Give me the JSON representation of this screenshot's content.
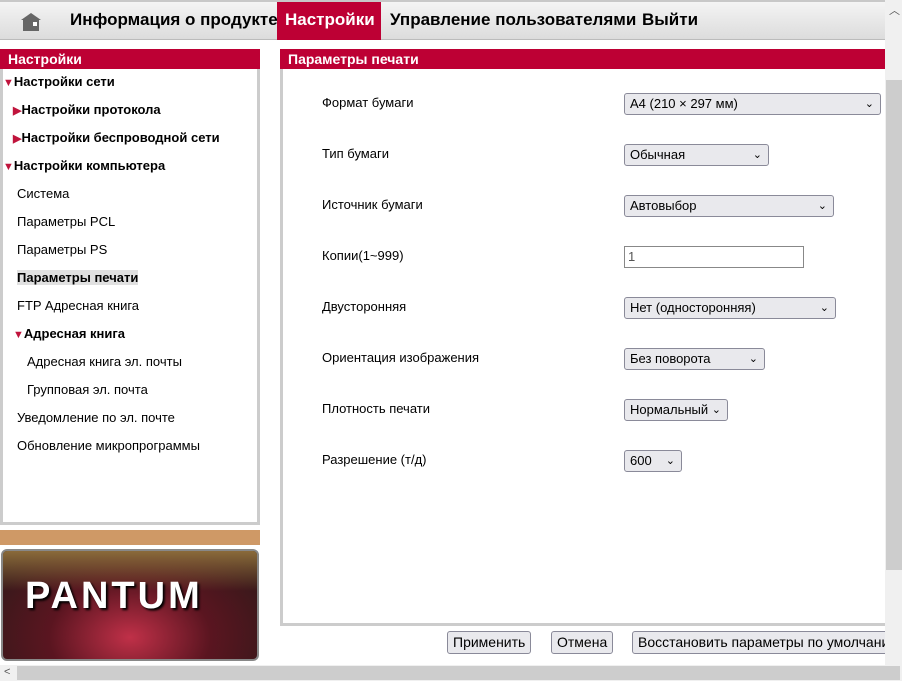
{
  "nav": {
    "items": [
      "Информация о продукте",
      "Настройки",
      "Управление пользователями",
      "Выйти"
    ],
    "active": "Настройки"
  },
  "sidebar": {
    "title": "Настройки",
    "items": [
      {
        "label": "Настройки сети",
        "level": 0,
        "expanded": true
      },
      {
        "label": "Настройки протокола",
        "level": 1,
        "collapsed": true
      },
      {
        "label": "Настройки беспроводной сети",
        "level": 1,
        "collapsed": true
      },
      {
        "label": "Настройки компьютера",
        "level": 0,
        "expanded": true
      },
      {
        "label": "Система"
      },
      {
        "label": "Параметры PCL"
      },
      {
        "label": "Параметры PS"
      },
      {
        "label": "Параметры печати",
        "selected": true
      },
      {
        "label": "FTP Адресная книга"
      },
      {
        "label": "Адресная книга",
        "expanded": true
      },
      {
        "label": "Адресная книга эл. почты"
      },
      {
        "label": "Групповая эл. почта"
      },
      {
        "label": "Уведомление по эл. почте"
      },
      {
        "label": "Обновление микропрограммы"
      }
    ]
  },
  "logo": "PANTUM",
  "main": {
    "title": "Параметры печати",
    "fields": [
      {
        "label": "Формат бумаги",
        "value": "A4 (210 × 297 мм)"
      },
      {
        "label": "Тип бумаги",
        "value": "Обычная"
      },
      {
        "label": "Источник бумаги",
        "value": "Автовыбор"
      },
      {
        "label": "Копии(1~999)",
        "value": "1"
      },
      {
        "label": "Двусторонняя",
        "value": "Нет (односторонняя)"
      },
      {
        "label": "Ориентация изображения",
        "value": "Без поворота"
      },
      {
        "label": "Плотность печати",
        "value": "Нормальный"
      },
      {
        "label": "Разрешение (т/д)",
        "value": "600"
      }
    ]
  },
  "buttons": {
    "apply": "Применить",
    "cancel": "Отмена",
    "restore": "Восстановить параметры по умолчанию"
  },
  "colors": {
    "accent": "#bd0034",
    "tan": "#cf9966"
  }
}
